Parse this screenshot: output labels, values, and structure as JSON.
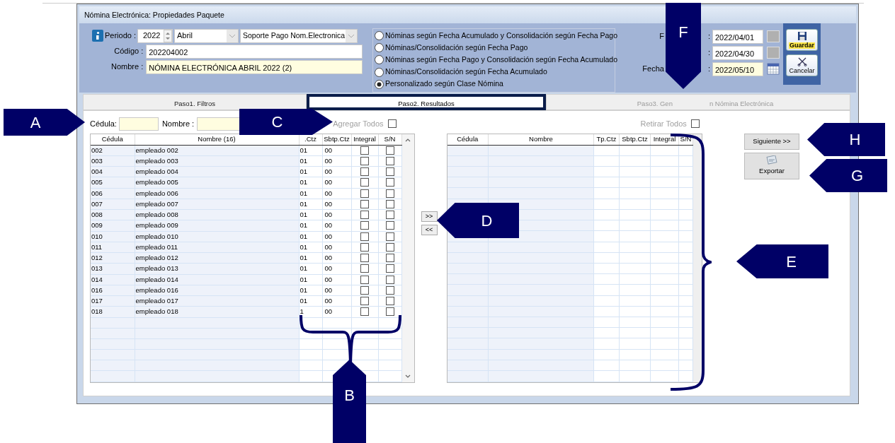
{
  "window": {
    "title": "Nómina Electrónica: Propiedades Paquete"
  },
  "header": {
    "periodo_label": "Periodo :",
    "year": "2022",
    "month": "Abril",
    "tipo": "Soporte Pago Nom.Electronica",
    "codigo_label": "Código :",
    "codigo": "202204002",
    "nombre_label": "Nombre :",
    "nombre": "NÓMINA ELECTRÓNICA ABRIL 2022 (2)"
  },
  "options": [
    {
      "label": "Nóminas según Fecha Acumulado y Consolidación según Fecha Pago",
      "selected": false
    },
    {
      "label": "Nóminas/Consolidación según Fecha Pago",
      "selected": false
    },
    {
      "label": "Nóminas según Fecha Pago y Consolidación según Fecha Acumulado",
      "selected": false
    },
    {
      "label": "Nóminas/Consolidación según Fecha Acumulado",
      "selected": false
    },
    {
      "label": "Personalizado según Clase Nómina",
      "selected": true
    }
  ],
  "dates": [
    {
      "label": "F",
      "colon": ":",
      "value": "2022/04/01",
      "kind": "plain"
    },
    {
      "colon": ":",
      "value": "2022/04/30",
      "kind": "plain"
    },
    {
      "label": "Fecha",
      "colon": ":",
      "value": "2022/05/10",
      "kind": "calendar"
    }
  ],
  "actions": [
    {
      "label": "Guardar",
      "kind": "save"
    },
    {
      "label": "Cancelar",
      "kind": "cancel"
    }
  ],
  "tabs": [
    {
      "label_parts": [
        "Paso1. Filtros"
      ],
      "selected": false,
      "highlighted": false
    },
    {
      "label_parts": [
        "Paso2. Resultados"
      ],
      "selected": true,
      "highlighted": true
    },
    {
      "label_parts": [
        "Paso3. Gen",
        "n Nómina Electrónica"
      ],
      "selected": false,
      "highlighted": false
    }
  ],
  "filters": {
    "cedula_label": "Cédula:",
    "nombre_label": "Nombre :",
    "add_all": {
      "label": "Agregar Todos",
      "checked": false
    },
    "remove_all": {
      "label": "Retirar Todos",
      "checked": false
    }
  },
  "left_table": {
    "columns": [
      "Cédula",
      "Nombre (16)",
      ".Ctz",
      "Sbtp.Ctz",
      "Integral",
      "S/N"
    ],
    "rows": [
      {
        "cedula": "002",
        "nombre": "empleado 002",
        "tp": "01",
        "sbtp": "00",
        "integral": false,
        "sn": false
      },
      {
        "cedula": "003",
        "nombre": "empleado 003",
        "tp": "01",
        "sbtp": "00",
        "integral": false,
        "sn": false
      },
      {
        "cedula": "004",
        "nombre": "empleado 004",
        "tp": "01",
        "sbtp": "00",
        "integral": false,
        "sn": false
      },
      {
        "cedula": "005",
        "nombre": "empleado 005",
        "tp": "01",
        "sbtp": "00",
        "integral": false,
        "sn": false
      },
      {
        "cedula": "006",
        "nombre": "empleado 006",
        "tp": "01",
        "sbtp": "00",
        "integral": false,
        "sn": false
      },
      {
        "cedula": "007",
        "nombre": "empleado 007",
        "tp": "01",
        "sbtp": "00",
        "integral": false,
        "sn": false
      },
      {
        "cedula": "008",
        "nombre": "empleado 008",
        "tp": "01",
        "sbtp": "00",
        "integral": false,
        "sn": false
      },
      {
        "cedula": "009",
        "nombre": "empleado 009",
        "tp": "01",
        "sbtp": "00",
        "integral": false,
        "sn": false
      },
      {
        "cedula": "010",
        "nombre": "empleado 010",
        "tp": "01",
        "sbtp": "00",
        "integral": false,
        "sn": false
      },
      {
        "cedula": "011",
        "nombre": "empleado 011",
        "tp": "01",
        "sbtp": "00",
        "integral": false,
        "sn": false
      },
      {
        "cedula": "012",
        "nombre": "empleado 012",
        "tp": "01",
        "sbtp": "00",
        "integral": false,
        "sn": false
      },
      {
        "cedula": "013",
        "nombre": "empleado 013",
        "tp": "01",
        "sbtp": "00",
        "integral": false,
        "sn": false
      },
      {
        "cedula": "014",
        "nombre": "empleado 014",
        "tp": "01",
        "sbtp": "00",
        "integral": false,
        "sn": false
      },
      {
        "cedula": "016",
        "nombre": "empleado 016",
        "tp": "01",
        "sbtp": "00",
        "integral": false,
        "sn": false
      },
      {
        "cedula": "017",
        "nombre": "empleado 017",
        "tp": "01",
        "sbtp": "00",
        "integral": false,
        "sn": false
      },
      {
        "cedula": "018",
        "nombre": "empleado 018",
        "tp": "1",
        "sbtp": "00",
        "integral": false,
        "sn": false
      }
    ]
  },
  "move_buttons": [
    ">>",
    "<<"
  ],
  "right_table": {
    "columns": [
      "Cédula",
      "Nombre",
      "Tp.Ctz",
      "Sbtp.Ctz",
      "Integral",
      "S/N"
    ]
  },
  "side_buttons": [
    {
      "label": "Siguiente >>",
      "kind": "next"
    },
    {
      "label": "Exportar",
      "kind": "export"
    }
  ],
  "callouts": [
    {
      "letter": "A",
      "brace": false
    },
    {
      "letter": "B",
      "brace": true
    },
    {
      "letter": "C",
      "brace": false
    },
    {
      "letter": "D",
      "brace": false
    },
    {
      "letter": "E",
      "brace": true
    },
    {
      "letter": "F",
      "brace": false
    },
    {
      "letter": "G",
      "brace": false
    },
    {
      "letter": "H",
      "brace": false
    }
  ]
}
